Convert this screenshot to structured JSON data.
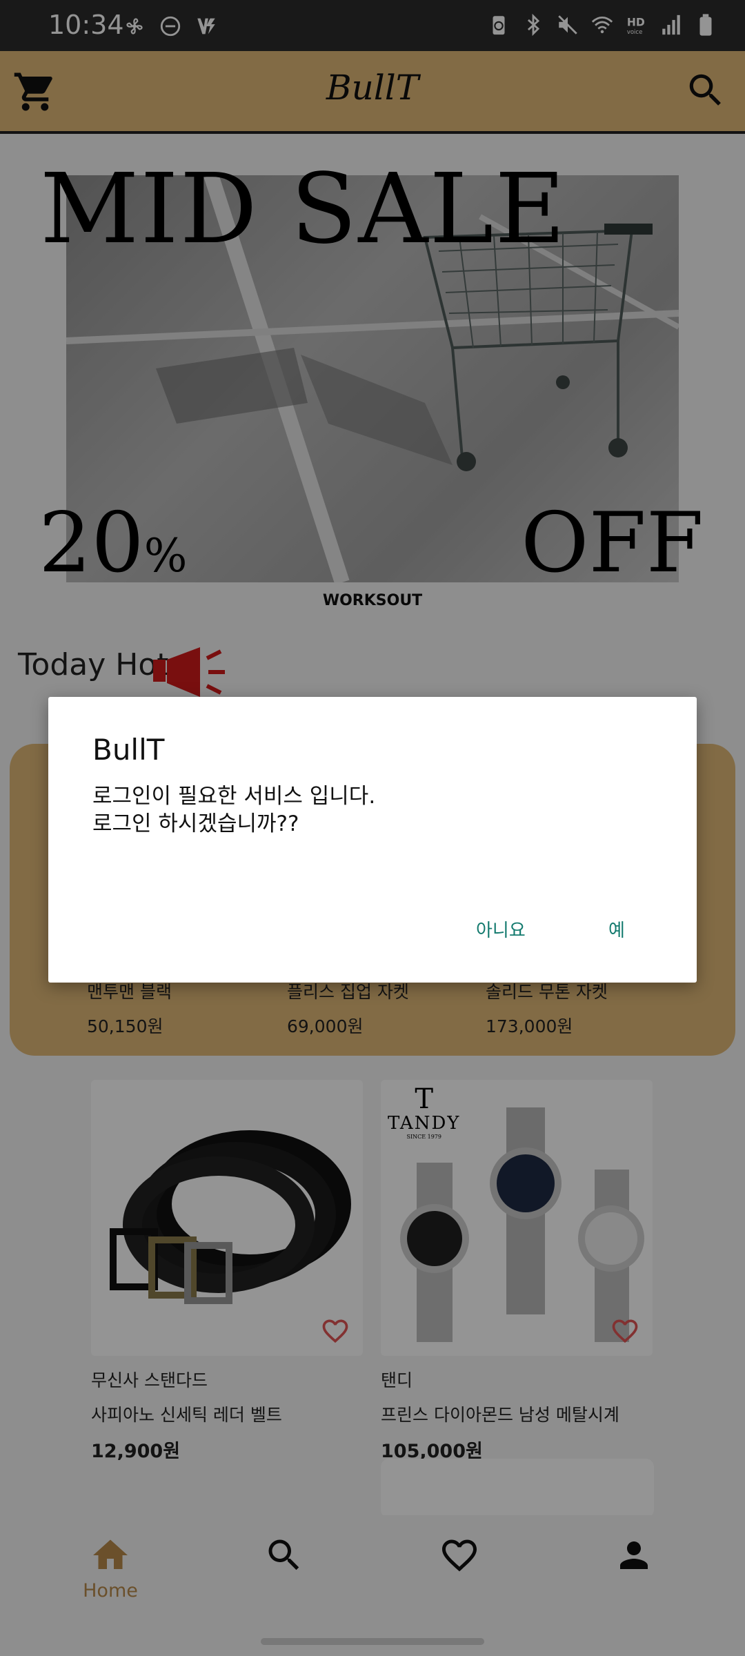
{
  "status_bar": {
    "time": "10:34"
  },
  "app_bar": {
    "title": "BullT"
  },
  "banner": {
    "headline": "MID SALE",
    "discount_number": "20",
    "discount_percent": "%",
    "discount_off": "OFF",
    "brand": "WORKSOUT"
  },
  "section": {
    "today_hot": "Today Hot"
  },
  "hot_items": [
    {
      "name": "맨투맨 블랙",
      "price": "50,150원"
    },
    {
      "name": "플리스 집업 자켓",
      "price": "69,000원"
    },
    {
      "name": "솔리드 무톤 자켓",
      "price": "173,000원"
    }
  ],
  "products": [
    {
      "brand": "무신사 스탠다드",
      "title": "사피아노 신세틱 레더 벨트",
      "price": "12,900원"
    },
    {
      "brand": "탠디",
      "title": "프린스 다이아몬드 남성 메탈시계",
      "price": "105,000원",
      "logo": {
        "mark": "T",
        "name": "TANDY",
        "since": "SINCE 1979"
      }
    }
  ],
  "bottom_nav": {
    "home_label": "Home"
  },
  "dialog": {
    "title": "BullT",
    "message": "로그인이 필요한 서비스 입니다.\n로그인 하시겠습니까??",
    "no_label": "아니요",
    "yes_label": "예"
  },
  "colors": {
    "accent": "#e0b878",
    "dialog_button": "#137a6e",
    "heart": "#e05555"
  }
}
